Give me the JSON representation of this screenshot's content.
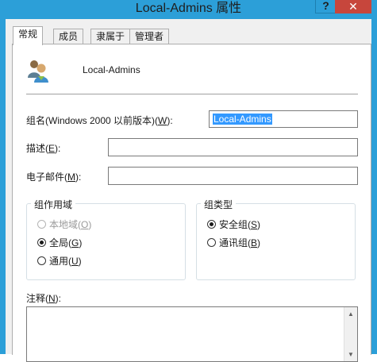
{
  "window": {
    "title": "Local-Admins 属性",
    "help_label": "?",
    "close_label": "✕"
  },
  "tabs": [
    {
      "label": "常规",
      "active": true
    },
    {
      "label": "成员"
    },
    {
      "label": "隶属于"
    },
    {
      "label": "管理者"
    }
  ],
  "general": {
    "group_name": "Local-Admins",
    "pre2000_label": "组名(Windows 2000 以前版本)(",
    "pre2000_key": "W",
    "pre2000_suffix": "):",
    "pre2000_value": "Local-Admins",
    "description_label": "描述(",
    "description_key": "E",
    "description_suffix": "):",
    "description_value": "",
    "email_label": "电子邮件(",
    "email_key": "M",
    "email_suffix": "):",
    "email_value": "",
    "notes_label": "注释(",
    "notes_key": "N",
    "notes_suffix": "):",
    "notes_value": ""
  },
  "group_scope": {
    "title": "组作用域",
    "options": [
      {
        "label": "本地域(",
        "key": "O",
        "suffix": ")",
        "checked": false,
        "disabled": true
      },
      {
        "label": "全局(",
        "key": "G",
        "suffix": ")",
        "checked": true,
        "disabled": false
      },
      {
        "label": "通用(",
        "key": "U",
        "suffix": ")",
        "checked": false,
        "disabled": false
      }
    ]
  },
  "group_type": {
    "title": "组类型",
    "options": [
      {
        "label": "安全组(",
        "key": "S",
        "suffix": ")",
        "checked": true
      },
      {
        "label": "通讯组(",
        "key": "B",
        "suffix": ")",
        "checked": false
      }
    ]
  },
  "icons": {
    "group": "group-users-icon",
    "scroll_up": "scroll-up-arrow-icon",
    "scroll_down": "scroll-down-arrow-icon"
  },
  "colors": {
    "title_bar": "#2c9fd8",
    "close_button": "#c7463c",
    "selection": "#3399ff"
  }
}
